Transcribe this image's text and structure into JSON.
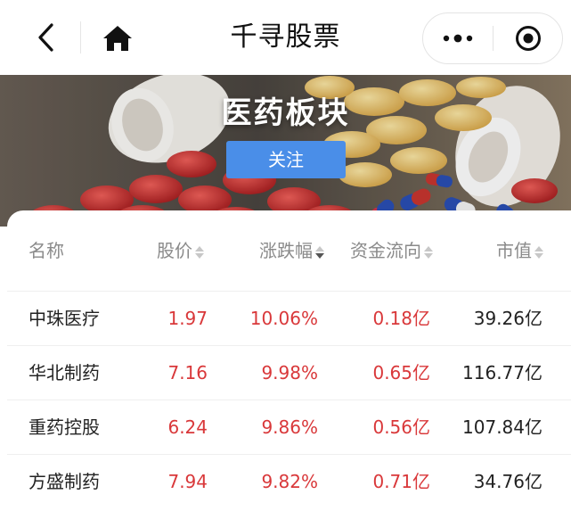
{
  "navbar": {
    "title": "千寻股票",
    "back_icon": "chevron-left-icon",
    "home_icon": "home-icon",
    "more_icon": "more-dots-icon",
    "close_icon": "target-close-icon"
  },
  "banner": {
    "title": "医药板块",
    "follow_label": "关注",
    "follow_color": "#4a8ee8"
  },
  "table": {
    "headers": {
      "name": "名称",
      "price": "股价",
      "change": "涨跌幅",
      "flow": "资金流向",
      "cap": "市值"
    },
    "active_sort": "change-desc",
    "rise_color": "#d9383a",
    "rows": [
      {
        "name": "中珠医疗",
        "price": "1.97",
        "change": "10.06%",
        "flow": "0.18亿",
        "cap": "39.26亿"
      },
      {
        "name": "华北制药",
        "price": "7.16",
        "change": "9.98%",
        "flow": "0.65亿",
        "cap": "116.77亿"
      },
      {
        "name": "重药控股",
        "price": "6.24",
        "change": "9.86%",
        "flow": "0.56亿",
        "cap": "107.84亿"
      },
      {
        "name": "方盛制药",
        "price": "7.94",
        "change": "9.82%",
        "flow": "0.71亿",
        "cap": "34.76亿"
      }
    ]
  }
}
